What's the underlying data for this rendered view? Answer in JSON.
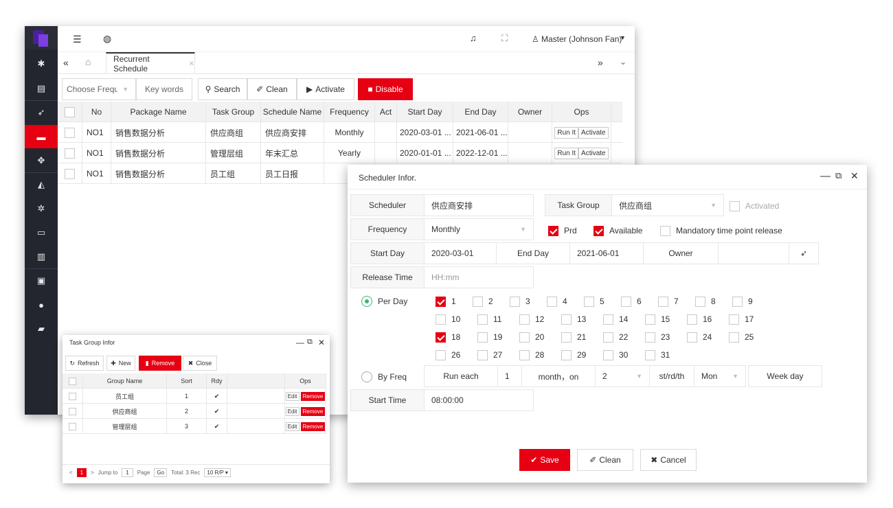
{
  "topbar": {
    "user": "Master (Johnson Fan)"
  },
  "tabs": {
    "active": "Recurrent Schedule"
  },
  "toolbar": {
    "frequency_placeholder": "Choose Frequency",
    "keywords_placeholder": "Key words",
    "search": "Search",
    "clean": "Clean",
    "activate": "Activate",
    "disable": "Disable"
  },
  "table": {
    "headers": [
      "No",
      "Package Name",
      "Task Group",
      "Schedule Name",
      "Frequency",
      "Act",
      "Start Day",
      "End Day",
      "Owner",
      "Ops"
    ],
    "rows": [
      {
        "no": "NO1",
        "package": "销售数据分析",
        "group": "供应商组",
        "schedule": "供应商安排",
        "freq": "Monthly",
        "start": "2020-03-01 ...",
        "end": "2021-06-01 ..."
      },
      {
        "no": "NO1",
        "package": "销售数据分析",
        "group": "管理层组",
        "schedule": "年末汇总",
        "freq": "Yearly",
        "start": "2020-01-01 ...",
        "end": "2022-12-01 ..."
      },
      {
        "no": "NO1",
        "package": "销售数据分析",
        "group": "员工组",
        "schedule": "员工日报",
        "freq": "",
        "start": "",
        "end": ""
      }
    ],
    "run_it": "Run It",
    "activate": "Activate"
  },
  "taskgroup": {
    "title": "Task Group Infor",
    "refresh": "Refresh",
    "new": "New",
    "remove": "Remove",
    "close": "Close",
    "headers": [
      "Group Name",
      "Sort",
      "Rdy",
      "Ops"
    ],
    "rows": [
      {
        "name": "员工组",
        "sort": "1"
      },
      {
        "name": "供应商组",
        "sort": "2"
      },
      {
        "name": "管理层组",
        "sort": "3"
      }
    ],
    "edit": "Edit",
    "row_remove": "Remove",
    "pager": {
      "page": "1",
      "jump_to": "Jump to",
      "jump_value": "1",
      "page_label": "Page",
      "go": "Go",
      "total": "Total: 3 Rec",
      "per_page": "10 R/P"
    }
  },
  "dialog": {
    "title": "Scheduler Infor.",
    "scheduler_label": "Scheduler",
    "scheduler_value": "供应商安排",
    "task_group_label": "Task Group",
    "task_group_value": "供应商组",
    "activated": "Activated",
    "frequency_label": "Frequency",
    "frequency_value": "Monthly",
    "prd": "Prd",
    "available": "Available",
    "mandatory": "Mandatory time point release",
    "start_day_label": "Start Day",
    "start_day_value": "2020-03-01",
    "end_day_label": "End Day",
    "end_day_value": "2021-06-01",
    "owner_label": "Owner",
    "release_time_label": "Release Time",
    "release_time_placeholder": "HH:mm",
    "per_day": "Per Day",
    "by_freq": "By Freq",
    "days": [
      "1",
      "2",
      "3",
      "4",
      "5",
      "6",
      "7",
      "8",
      "9",
      "10",
      "11",
      "12",
      "13",
      "14",
      "15",
      "16",
      "17",
      "18",
      "19",
      "20",
      "21",
      "22",
      "23",
      "24",
      "25",
      "26",
      "27",
      "28",
      "29",
      "30",
      "31"
    ],
    "checked_days": [
      "1",
      "18"
    ],
    "run_each": "Run each",
    "run_each_value": "1",
    "month_on": "month，on",
    "ordinal_value": "2",
    "st_rd_th": "st/rd/th",
    "weekday_value": "Mon",
    "week_day": "Week day",
    "start_time_label": "Start Time",
    "start_time_value": "08:00:00",
    "save": "Save",
    "clean": "Clean",
    "cancel": "Cancel"
  },
  "colors": {
    "accent": "#e60012",
    "sidebar": "#23262e",
    "radio": "#3cb371"
  }
}
